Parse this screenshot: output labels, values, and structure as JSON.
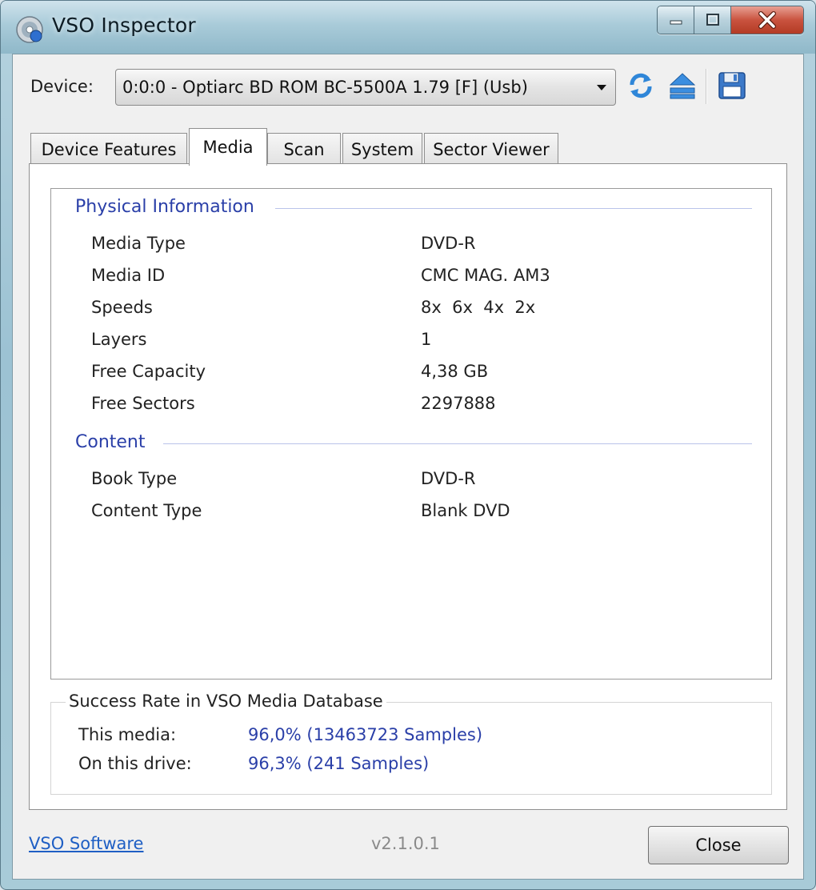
{
  "window": {
    "title": "VSO Inspector"
  },
  "device": {
    "label": "Device:",
    "selected": "0:0:0 - Optiarc BD ROM BC-5500A 1.79 [F] (Usb)"
  },
  "tabs": [
    {
      "label": "Device Features",
      "active": false
    },
    {
      "label": "Media",
      "active": true
    },
    {
      "label": "Scan",
      "active": false
    },
    {
      "label": "System",
      "active": false
    },
    {
      "label": "Sector Viewer",
      "active": false
    }
  ],
  "physical": {
    "title": "Physical Information",
    "rows": [
      {
        "label": "Media Type",
        "value": "DVD-R"
      },
      {
        "label": "Media ID",
        "value": "CMC MAG. AM3"
      },
      {
        "label": "Speeds",
        "value": "8x  6x  4x  2x"
      },
      {
        "label": "Layers",
        "value": "1"
      },
      {
        "label": "Free Capacity",
        "value": "4,38 GB"
      },
      {
        "label": "Free Sectors",
        "value": "2297888"
      }
    ]
  },
  "content": {
    "title": "Content",
    "rows": [
      {
        "label": "Book Type",
        "value": "DVD-R"
      },
      {
        "label": "Content Type",
        "value": "Blank DVD"
      }
    ]
  },
  "success": {
    "title": "Success Rate in VSO Media Database",
    "rows": [
      {
        "label": "This media:",
        "value": "96,0% (13463723 Samples)"
      },
      {
        "label": "On this drive:",
        "value": "96,3% (241 Samples)"
      }
    ]
  },
  "footer": {
    "link": "VSO Software",
    "version": "v2.1.0.1",
    "close_label": "Close"
  },
  "colors": {
    "accent_text": "#2a3fa8",
    "link": "#1f5fc4"
  },
  "icons": {
    "app": "disc-icon",
    "refresh": "refresh-icon",
    "eject": "eject-icon",
    "save": "save-icon"
  }
}
